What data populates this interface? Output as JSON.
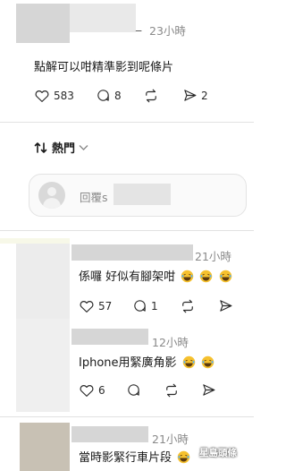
{
  "top_post": {
    "username_fragment": "_",
    "time": "23小時",
    "text": "點解可以咁精準影到呢條片",
    "likes": "583",
    "comments": "8",
    "shares": "2"
  },
  "sort": {
    "label": "熱門"
  },
  "reply_box": {
    "placeholder": "回覆s"
  },
  "comments": [
    {
      "time": "21小時",
      "text": "係囉 好似有腳架咁",
      "emoji_count": 3,
      "likes": "57",
      "replies": "1"
    },
    {
      "time": "12小時",
      "text": "Iphone用緊廣角影",
      "emoji_count": 2,
      "likes": "6",
      "replies": ""
    },
    {
      "time": "21小時",
      "text": "當時影緊行車片段",
      "emoji_count": 1
    }
  ],
  "watermark": "星島頭條",
  "icons": [
    "heart-icon",
    "comment-icon",
    "repost-icon",
    "share-icon",
    "sort-icon",
    "chevron-down-icon",
    "avatar-placeholder-icon",
    "laughing-emoji-icon"
  ]
}
